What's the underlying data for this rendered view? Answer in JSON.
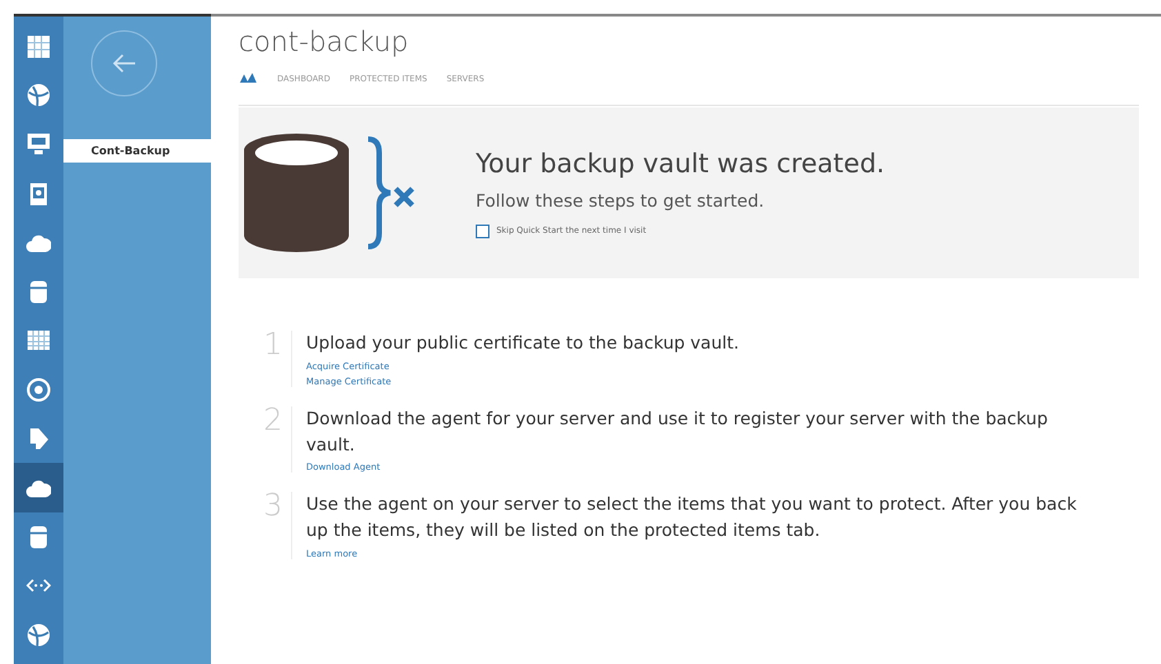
{
  "nav_rail": {
    "items": [
      {
        "selected": false
      },
      {
        "selected": false
      },
      {
        "selected": false
      },
      {
        "selected": false
      },
      {
        "selected": false
      },
      {
        "selected": false
      },
      {
        "selected": false
      },
      {
        "selected": false
      },
      {
        "selected": false
      },
      {
        "selected": true
      },
      {
        "selected": false
      },
      {
        "selected": false
      },
      {
        "selected": false
      }
    ]
  },
  "sidebar": {
    "items": [
      {
        "label": "Cont-Backup",
        "selected": true
      }
    ]
  },
  "header": {
    "title": "cont-backup"
  },
  "tabs": [
    {
      "kind": "icon",
      "selected": true
    },
    {
      "kind": "text",
      "label": "DASHBOARD",
      "selected": false
    },
    {
      "kind": "text",
      "label": "PROTECTED ITEMS",
      "selected": false
    },
    {
      "kind": "text",
      "label": "SERVERS",
      "selected": false
    }
  ],
  "banner": {
    "heading": "Your backup vault was created.",
    "subheading": "Follow these steps to get started.",
    "checkbox": {
      "label": "Skip Quick Start the next time I visit",
      "checked": false
    }
  },
  "steps": [
    {
      "number": "1",
      "text": "Upload your public certificate to the backup vault.",
      "links": [
        "Acquire Certificate",
        "Manage Certificate"
      ]
    },
    {
      "number": "2",
      "text": "Download the agent for your server and use it to register your server with the backup vault.",
      "links": [
        "Download Agent"
      ]
    },
    {
      "number": "3",
      "text": "Use the agent on your server to select the items that you want to protect. After you back up the items, they will be listed on the protected items tab.",
      "links": [
        "Learn more"
      ]
    }
  ]
}
